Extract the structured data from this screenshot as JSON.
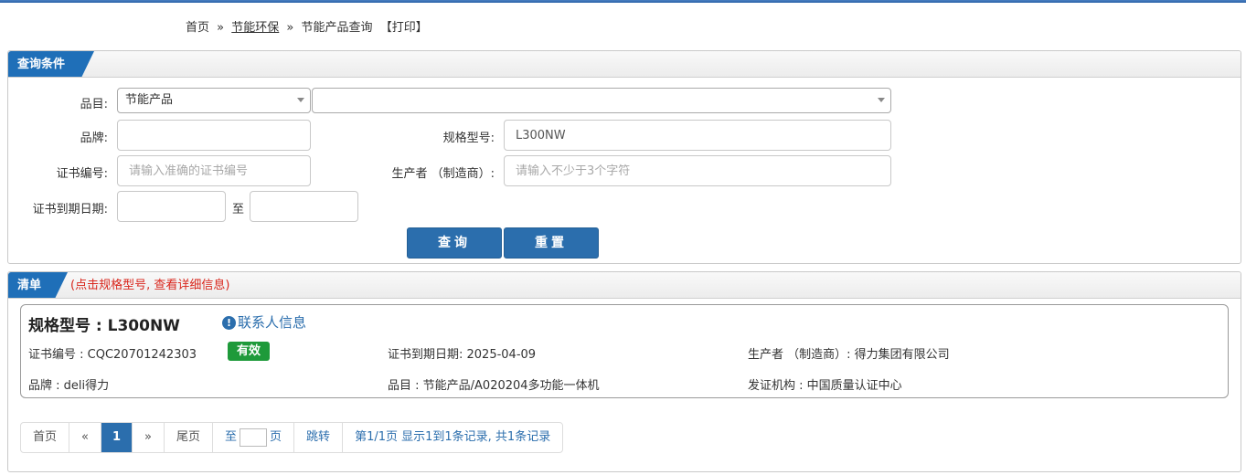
{
  "breadcrumb": {
    "home": "首页",
    "sep": "»",
    "section": "节能环保",
    "current": "节能产品查询",
    "print": "【打印】"
  },
  "query": {
    "title": "查询条件",
    "category_label": "品目:",
    "category_value": "节能产品",
    "subcategory_value": "",
    "brand_label": "品牌:",
    "brand_value": "",
    "model_label": "规格型号:",
    "model_value": "L300NW",
    "cert_label": "证书编号:",
    "cert_placeholder": "请输入准确的证书编号",
    "maker_label": "生产者 （制造商）:",
    "maker_placeholder": "请输入不少于3个字符",
    "date_label": "证书到期日期:",
    "date_to": "至",
    "search_button": "查询",
    "reset_button": "重置"
  },
  "list": {
    "title": "清单",
    "hint": "(点击规格型号, 查看详细信息)",
    "items": [
      {
        "model": "规格型号 : L300NW",
        "contact": "联系人信息",
        "cert_no": "证书编号 : CQC20701242303",
        "status": "有效",
        "expiry": "证书到期日期: 2025-04-09",
        "maker": "生产者 （制造商）: 得力集团有限公司",
        "brand": "品牌 : deli得力",
        "category": "品目 : 节能产品/A020204多功能一体机",
        "issuer": "发证机构 : 中国质量认证中心"
      }
    ]
  },
  "pager": {
    "first": "首页",
    "prev": "«",
    "current": "1",
    "next": "»",
    "last": "尾页",
    "goto_prefix": "至",
    "goto_suffix": "页",
    "jump": "跳转",
    "summary": "第1/1页  显示1到1条记录, 共1条记录"
  },
  "colors": {
    "accent": "#2b6ead",
    "tab": "#1f6fb8",
    "valid_badge": "#1e9a3a",
    "hint": "#d9261c"
  }
}
